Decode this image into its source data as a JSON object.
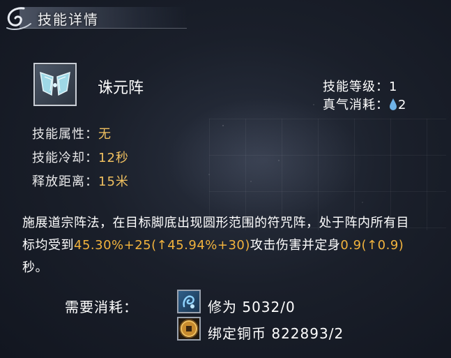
{
  "header": {
    "title": "技能详情"
  },
  "skill": {
    "name": "诛元阵",
    "level_label": "技能等级：",
    "level_value": "1",
    "cost_label": "真气消耗：",
    "cost_value": "2"
  },
  "attributes": [
    {
      "label": "技能属性：",
      "value": "无"
    },
    {
      "label": "技能冷却：",
      "value": "12秒"
    },
    {
      "label": "释放距离：",
      "value": "15米"
    }
  ],
  "description": {
    "part1": "施展道宗阵法，在目标脚底出现圆形范围的符咒阵，处于阵内所有目标均受到",
    "hl1": "45.30%+25(",
    "up_arrow": "↑",
    "hl2": "45.94%+30)",
    "part2": "攻击伤害并定身",
    "hl3": "0.9(",
    "hl4": "0.9)",
    "part3": "秒。"
  },
  "requirements": {
    "label": "需要消耗：",
    "items": [
      {
        "name": "修为",
        "value": "5032/0",
        "icon": "cultivation-icon"
      },
      {
        "name": "绑定铜币",
        "value": "822893/2",
        "icon": "bound-coin-icon"
      }
    ]
  },
  "colors": {
    "highlight": "#f2b33d",
    "attr_value": "#f0c060",
    "drop": "#6fb3e8"
  }
}
